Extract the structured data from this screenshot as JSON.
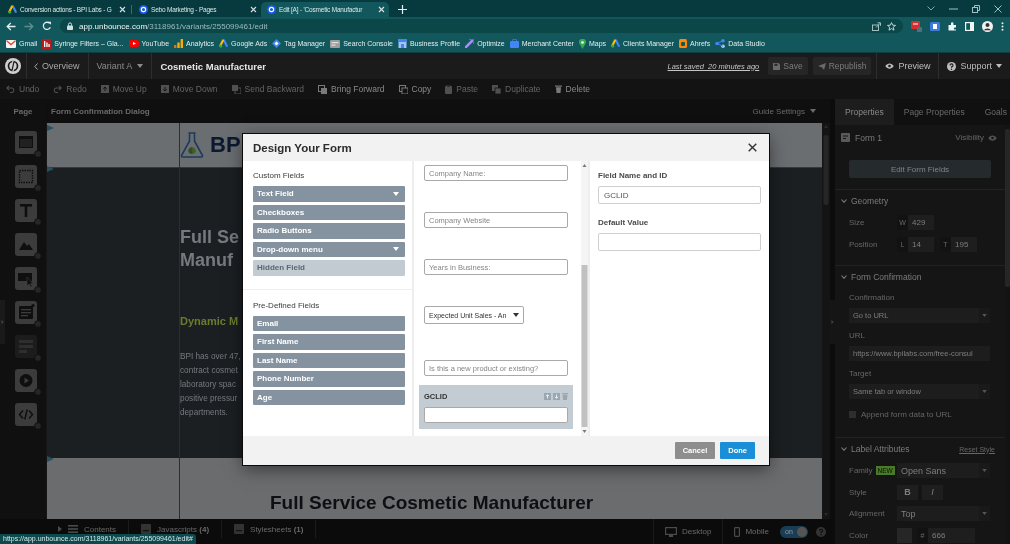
{
  "browser": {
    "tabs": [
      {
        "title": "Conversion actions - BPI Labs - G",
        "kind": "ads",
        "selected": false
      },
      {
        "title": "Sebo Marketing - Pages",
        "kind": "unbounce",
        "selected": false
      },
      {
        "title": "Edit [A] - 'Cosmetic Manufactur",
        "kind": "unbounce",
        "selected": true
      }
    ],
    "nav_buttons": [
      {
        "kind": "back",
        "disabled": false
      },
      {
        "kind": "forward",
        "disabled": true
      },
      {
        "kind": "reload",
        "disabled": false
      }
    ],
    "address": {
      "host": "app.unbounce.com",
      "path": "/3118961/variants/255099461/edit"
    },
    "bookmarks": [
      {
        "label": "Gmail",
        "kind": "mail"
      },
      {
        "label": "Syringe Filters – Gla...",
        "kind": "page"
      },
      {
        "label": "YouTube",
        "kind": "video"
      },
      {
        "label": "Analytics",
        "kind": "chart"
      },
      {
        "label": "Google Ads",
        "kind": "ads"
      },
      {
        "label": "Tag Manager",
        "kind": "tag"
      },
      {
        "label": "Search Console",
        "kind": "console"
      },
      {
        "label": "Business Profile",
        "kind": "store"
      },
      {
        "label": "Optimize",
        "kind": "optimize"
      },
      {
        "label": "Merchant Center",
        "kind": "merchant"
      },
      {
        "label": "Maps",
        "kind": "pin"
      },
      {
        "label": "Clients Manager",
        "kind": "ads"
      },
      {
        "label": "Ahrefs",
        "kind": "ahrefs"
      },
      {
        "label": "Data Studio",
        "kind": "studio"
      }
    ],
    "status_url": "https://app.unbounce.com/3118961/variants/255099461/edit#"
  },
  "editor": {
    "header": {
      "back_link": "Overview",
      "variant": "Variant A",
      "page_title": "Cosmetic Manufacturer",
      "last_saved": "Last saved  20 minutes ago",
      "actions": [
        {
          "label": "Save",
          "kind": "save",
          "disabled": true
        },
        {
          "label": "Republish",
          "kind": "publish",
          "disabled": true
        }
      ],
      "preview": "Preview",
      "support": "Support"
    },
    "toolbar": [
      {
        "label": "Undo",
        "kind": "undo",
        "disabled": true
      },
      {
        "label": "Redo",
        "kind": "redo",
        "disabled": true
      },
      {
        "label": "Move Up",
        "kind": "up",
        "disabled": true
      },
      {
        "label": "Move Down",
        "kind": "down",
        "disabled": true
      },
      {
        "label": "Send Backward",
        "kind": "backward",
        "disabled": true
      },
      {
        "label": "Bring Forward",
        "kind": "forward",
        "disabled": false
      },
      {
        "label": "Copy",
        "kind": "copy",
        "disabled": false
      },
      {
        "label": "Paste",
        "kind": "paste",
        "disabled": true
      },
      {
        "label": "Duplicate",
        "kind": "duplicate",
        "disabled": true
      },
      {
        "label": "Delete",
        "kind": "delete",
        "disabled": false
      }
    ],
    "sidebar": {
      "tab": "Page",
      "tools": [
        {
          "kind": "section",
          "disabled": false
        },
        {
          "kind": "box",
          "disabled": false
        },
        {
          "kind": "text",
          "disabled": false
        },
        {
          "kind": "image",
          "disabled": false
        },
        {
          "kind": "button",
          "disabled": false
        },
        {
          "kind": "lightbox",
          "disabled": false
        },
        {
          "kind": "form",
          "disabled": true
        },
        {
          "kind": "video",
          "disabled": false
        },
        {
          "kind": "html",
          "disabled": false
        }
      ]
    },
    "canvas": {
      "title": "Form Confirmation Dialog",
      "guide_settings": "Guide Settings",
      "logo_text": "BP",
      "hero_title_lines": [
        "Full Se",
        "Manuf"
      ],
      "hero_subtitle": "Dynamic M",
      "hero_text_lines": [
        "BPI has over 47,",
        "contract cosmet",
        "laboratory spac",
        "positive pressur",
        "departments."
      ],
      "section_title": "Full Service Cosmetic Manufacturer"
    },
    "bottom_bar": {
      "panels": [
        {
          "label": "Contents",
          "kind": "contents"
        },
        {
          "label": "Javascripts **(4)**",
          "kind": "js"
        },
        {
          "label": "Stylesheets **(1)**",
          "kind": "css"
        }
      ],
      "views": [
        {
          "label": "Desktop",
          "kind": "desktop"
        },
        {
          "label": "Mobile",
          "kind": "mobile"
        }
      ],
      "mobile_toggle": {
        "label": "on",
        "on": true
      }
    },
    "properties": {
      "tabs": [
        {
          "label": "Properties",
          "selected": true
        },
        {
          "label": "Page Properties",
          "selected": false
        },
        {
          "label": "Goals",
          "selected": false
        }
      ],
      "element": "Form 1",
      "visibility": "Visibility",
      "edit_button": "Edit Form Fields",
      "sections": [
        {
          "title": "Geometry",
          "expanded": true,
          "rows": [
            {
              "kind": "boxes",
              "label": "Size",
              "fields": [
                {
                  "prefix": "W",
                  "value": "429"
                }
              ]
            },
            {
              "kind": "boxes",
              "label": "Position",
              "fields": [
                {
                  "prefix": "L",
                  "value": "14"
                },
                {
                  "prefix": "T",
                  "value": "195"
                }
              ]
            }
          ]
        },
        {
          "title": "Form Confirmation",
          "expanded": true,
          "rows": [
            {
              "kind": "dropdown",
              "label": "Confirmation",
              "value": "Go to URL"
            },
            {
              "kind": "textbox",
              "label": "URL",
              "value": "https://www.bpilabs.com/free-consul"
            },
            {
              "kind": "dropdown",
              "label": "Target",
              "value": "Same tab or window"
            },
            {
              "kind": "checkbox",
              "label": "Append form data to URL",
              "checked": false
            }
          ]
        },
        {
          "title": "Label Attributes",
          "expanded": true,
          "action": "Reset Style",
          "rows": [
            {
              "kind": "select",
              "label": "Family",
              "badge": "NEW",
              "value": "Open Sans"
            },
            {
              "kind": "style",
              "label": "Style",
              "buttons": [
                {
                  "label": "B",
                  "kind": "bold"
                },
                {
                  "label": "I",
                  "kind": "italic"
                }
              ]
            },
            {
              "kind": "select",
              "label": "Alignment",
              "value": "Top"
            },
            {
              "kind": "color",
              "label": "Color",
              "prefix": "#",
              "value": "666"
            }
          ]
        }
      ]
    }
  },
  "dialog": {
    "title": "Design Your Form",
    "custom_fields": {
      "title": "Custom Fields",
      "buttons": [
        {
          "label": "Text Field",
          "dropdown": true,
          "disabled": false
        },
        {
          "label": "Checkboxes",
          "dropdown": false,
          "disabled": false
        },
        {
          "label": "Radio Buttons",
          "dropdown": false,
          "disabled": false
        },
        {
          "label": "Drop-down menu",
          "dropdown": true,
          "disabled": false
        },
        {
          "label": "Hidden Field",
          "dropdown": false,
          "disabled": true
        }
      ]
    },
    "predefined_fields": {
      "title": "Pre-Defined Fields",
      "buttons": [
        {
          "label": "Email"
        },
        {
          "label": "First Name"
        },
        {
          "label": "Last Name"
        },
        {
          "label": "Phone Number"
        },
        {
          "label": "Age"
        }
      ]
    },
    "form_fields": [
      {
        "kind": "input",
        "placeholder": "Company Name:",
        "selected": false
      },
      {
        "kind": "input",
        "placeholder": "Company Website",
        "selected": false
      },
      {
        "kind": "input",
        "placeholder": "Years in Business:",
        "selected": false
      },
      {
        "kind": "select",
        "value": "Expected Unit Sales - An",
        "selected": false
      },
      {
        "kind": "input",
        "placeholder": "Is this a new product or existing?",
        "selected": false
      },
      {
        "kind": "input",
        "label": "GCLID",
        "selected": true
      }
    ],
    "settings": {
      "name_label": "Field Name and ID",
      "name_value": "GCLID",
      "default_label": "Default Value"
    },
    "buttons": [
      {
        "label": "Cancel",
        "kind": "secondary"
      },
      {
        "label": "Done",
        "kind": "primary"
      }
    ]
  }
}
